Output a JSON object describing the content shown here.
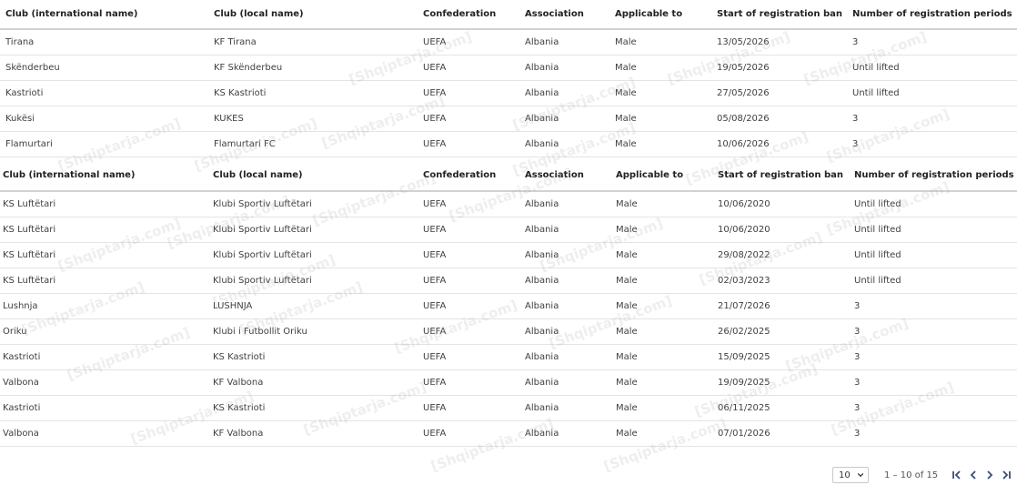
{
  "table_a": {
    "headers": [
      "Club (international name)",
      "Club (local name)",
      "Confederation",
      "Association",
      "Applicable to",
      "Start of registration ban",
      "Number of registration periods"
    ],
    "rows": [
      [
        "Tirana",
        "KF Tirana",
        "UEFA",
        "Albania",
        "Male",
        "13/05/2026",
        "3"
      ],
      [
        "Skënderbeu",
        "KF Skënderbeu",
        "UEFA",
        "Albania",
        "Male",
        "19/05/2026",
        "Until lifted"
      ],
      [
        "Kastrioti",
        "KS Kastrioti",
        "UEFA",
        "Albania",
        "Male",
        "27/05/2026",
        "Until lifted"
      ],
      [
        "Kukësi",
        "KUKES",
        "UEFA",
        "Albania",
        "Male",
        "05/08/2026",
        "3"
      ],
      [
        "Flamurtari",
        "Flamurtari FC",
        "UEFA",
        "Albania",
        "Male",
        "10/06/2026",
        "3"
      ]
    ]
  },
  "table_b": {
    "headers": [
      "Club (international name)",
      "Club (local name)",
      "Confederation",
      "Association",
      "Applicable to",
      "Start of registration ban",
      "Number of registration periods"
    ],
    "rows": [
      [
        "KS Luftëtari",
        "Klubi Sportiv Luftëtari",
        "UEFA",
        "Albania",
        "Male",
        "10/06/2020",
        "Until lifted"
      ],
      [
        "KS Luftëtari",
        "Klubi Sportiv Luftëtari",
        "UEFA",
        "Albania",
        "Male",
        "10/06/2020",
        "Until lifted"
      ],
      [
        "KS Luftëtari",
        "Klubi Sportiv Luftëtari",
        "UEFA",
        "Albania",
        "Male",
        "29/08/2022",
        "Until lifted"
      ],
      [
        "KS Luftëtari",
        "Klubi Sportiv Luftëtari",
        "UEFA",
        "Albania",
        "Male",
        "02/03/2023",
        "Until lifted"
      ],
      [
        "Lushnja",
        "LUSHNJA",
        "UEFA",
        "Albania",
        "Male",
        "21/07/2026",
        "3"
      ],
      [
        "Oriku",
        "Klubi i Futbollit Oriku",
        "UEFA",
        "Albania",
        "Male",
        "26/02/2025",
        "3"
      ],
      [
        "Kastrioti",
        "KS Kastrioti",
        "UEFA",
        "Albania",
        "Male",
        "15/09/2025",
        "3"
      ],
      [
        "Valbona",
        "KF Valbona",
        "UEFA",
        "Albania",
        "Male",
        "19/09/2025",
        "3"
      ],
      [
        "Kastrioti",
        "KS Kastrioti",
        "UEFA",
        "Albania",
        "Male",
        "06/11/2025",
        "3"
      ],
      [
        "Valbona",
        "KF Valbona",
        "UEFA",
        "Albania",
        "Male",
        "07/01/2026",
        "3"
      ]
    ]
  },
  "pagination": {
    "page_size": "10",
    "range_label": "1 – 10 of 15"
  },
  "watermark_text": "[Shqiptarja.com]",
  "icons": {
    "page_size": "chevron-down-icon",
    "first": "first-page-icon",
    "prev": "previous-page-icon",
    "next": "next-page-icon",
    "last": "last-page-icon"
  },
  "colors": {
    "icon": "#3a4a7a",
    "header_border": "#d2d2d2",
    "row_border": "#e4e4e4"
  }
}
